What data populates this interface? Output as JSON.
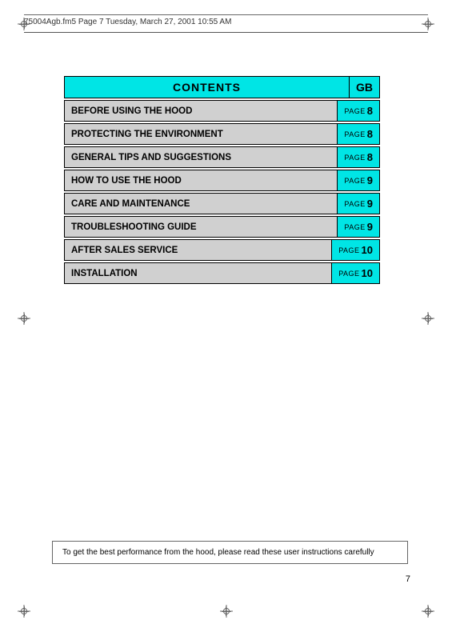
{
  "header": {
    "text": "75004Agb.fm5  Page 7  Tuesday, March 27, 2001  10:55 AM"
  },
  "contents": {
    "title": "CONTENTS",
    "gb_label": "GB",
    "rows": [
      {
        "label": "BEFORE USING THE HOOD",
        "page_word": "PAGE",
        "page_num": "8"
      },
      {
        "label": "PROTECTING THE ENVIRONMENT",
        "page_word": "PAGE",
        "page_num": "8"
      },
      {
        "label": "GENERAL TIPS AND SUGGESTIONS",
        "page_word": "PAGE",
        "page_num": "8"
      },
      {
        "label": "HOW TO USE THE HOOD",
        "page_word": "PAGE",
        "page_num": "9"
      },
      {
        "label": "CARE AND MAINTENANCE",
        "page_word": "PAGE",
        "page_num": "9"
      },
      {
        "label": "TROUBLESHOOTING GUIDE",
        "page_word": "PAGE",
        "page_num": "9"
      },
      {
        "label": "AFTER SALES SERVICE",
        "page_word": "PAGE",
        "page_num": "10"
      },
      {
        "label": "INSTALLATION",
        "page_word": "PAGE",
        "page_num": "10"
      }
    ]
  },
  "bottom_note": "To get the best performance from the hood, please read these user instructions carefully",
  "page_number": "7"
}
